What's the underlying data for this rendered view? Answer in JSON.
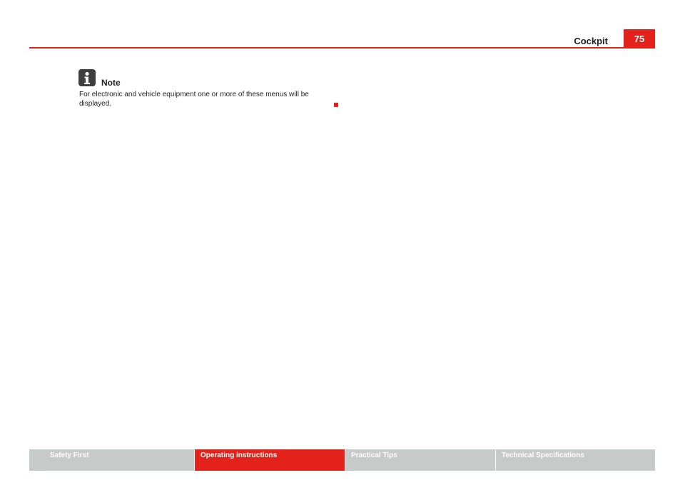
{
  "header": {
    "section_title": "Cockpit",
    "page_number": "75",
    "accent_color": "#e3231b"
  },
  "note": {
    "icon": "info-person-icon",
    "heading": "Note",
    "body": "For electronic and vehicle equipment one or more of these menus will be displayed."
  },
  "footer": {
    "tabs": [
      {
        "label": "Safety First",
        "active": false
      },
      {
        "label": "Operating instructions",
        "active": true
      },
      {
        "label": "Practical Tips",
        "active": false
      },
      {
        "label": "Technical Specifications",
        "active": false
      }
    ],
    "inactive_color": "#c6cbca",
    "active_color": "#e3231b"
  }
}
